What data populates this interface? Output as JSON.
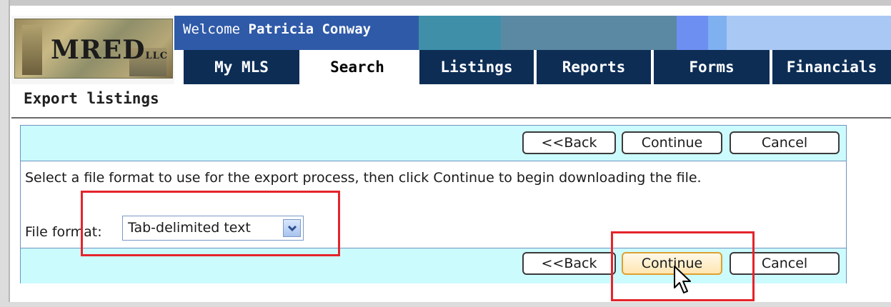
{
  "header": {
    "logo_text": "MRED",
    "logo_suffix": "LLC",
    "welcome_prefix": "Welcome ",
    "welcome_name": "Patricia Conway"
  },
  "tabs": [
    {
      "label": "My MLS",
      "active": false
    },
    {
      "label": "Search",
      "active": true
    },
    {
      "label": "Listings",
      "active": false
    },
    {
      "label": "Reports",
      "active": false
    },
    {
      "label": "Forms",
      "active": false
    },
    {
      "label": "Financials",
      "active": false
    }
  ],
  "page": {
    "title": "Export listings"
  },
  "buttons": {
    "back": "<<Back",
    "continue": "Continue",
    "cancel": "Cancel"
  },
  "form": {
    "instructions": "Select a file format to use for the export process, then click Continue to begin downloading the file.",
    "file_format_label": "File format:",
    "file_format_value": "Tab-delimited text"
  },
  "colors": {
    "tab_bg": "#0d2d55",
    "bar_bg": "#ccfbfd",
    "highlight": "#e5242b"
  }
}
